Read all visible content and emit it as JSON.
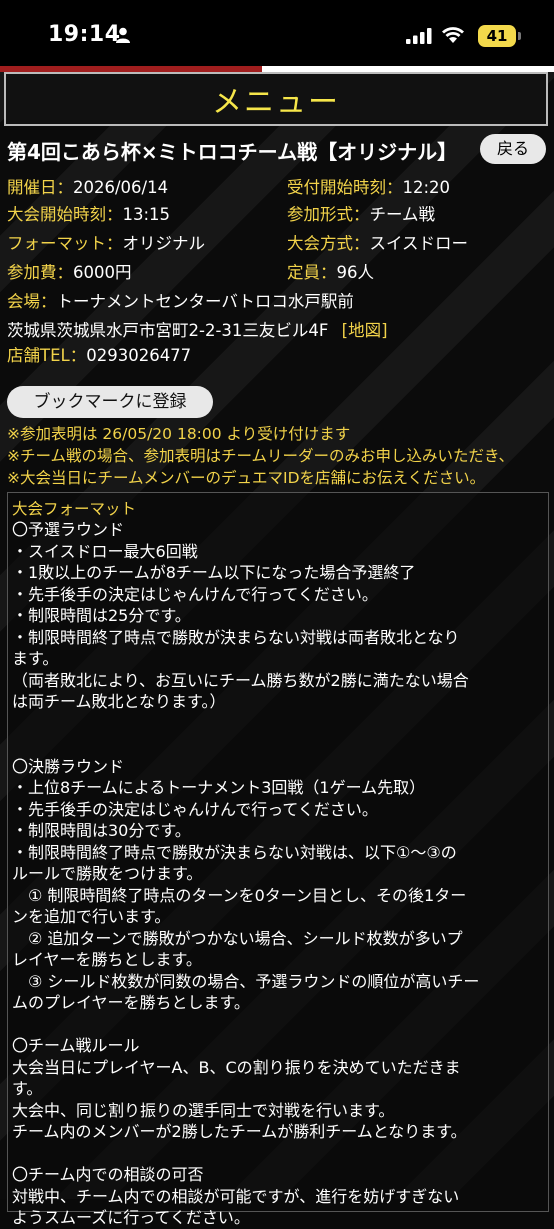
{
  "status_bar": {
    "time": "19:14",
    "battery": "41"
  },
  "menu": {
    "label": "メニュー"
  },
  "event": {
    "title": "第4回こあら杯×ミトロコチーム戦【オリジナル】",
    "back_label": "戻る",
    "info": [
      {
        "key": "開催日：",
        "value": "2026/06/14"
      },
      {
        "key": "受付開始時刻：",
        "value": "12:20"
      },
      {
        "key": "大会開始時刻：",
        "value": "13:15"
      },
      {
        "key": "参加形式：",
        "value": "チーム戦"
      },
      {
        "key": "フォーマット：",
        "value": "オリジナル"
      },
      {
        "key": "大会方式：",
        "value": "スイスドロー"
      },
      {
        "key": "参加費：",
        "value": "6000円"
      },
      {
        "key": "定員：",
        "value": "96人"
      }
    ],
    "venue_key": "会場：",
    "venue_value": "トーナメントセンターバトロコ水戸駅前",
    "address": "茨城県茨城県水戸市宮町2-2-31三友ビル4F",
    "map_link": "[地図]",
    "tel_key": "店舗TEL：",
    "tel_value": "0293026477",
    "bookmark_label": "ブックマークに登録",
    "notices": [
      "※参加表明は 26/05/20 18:00 より受け付けます",
      "※チーム戦の場合、参加表明はチームリーダーのみお申し込みいただき、",
      "※大会当日にチームメンバーのデュエマIDを店舗にお伝えください。"
    ]
  },
  "format": {
    "title": "大会フォーマット",
    "lines": [
      "〇予選ラウンド",
      "・スイスドロー最大6回戦",
      "・1敗以上のチームが8チーム以下になった場合予選終了",
      "・先手後手の決定はじゃんけんで行ってください。",
      "・制限時間は25分です。",
      "・制限時間終了時点で勝敗が決まらない対戦は両者敗北となり",
      "ます。",
      "（両者敗北により、お互いにチーム勝ち数が2勝に満たない場合",
      "は両チーム敗北となります。）",
      "",
      "",
      "〇決勝ラウンド",
      "・上位8チームによるトーナメント3回戦（1ゲーム先取）",
      "・先手後手の決定はじゃんけんで行ってください。",
      "・制限時間は30分です。",
      "・制限時間終了時点で勝敗が決まらない対戦は、以下①～③の",
      "ルールで勝敗をつけます。",
      "　① 制限時間終了時点のターンを0ターン目とし、その後1ター",
      "ンを追加で行います。",
      "　② 追加ターンで勝敗がつかない場合、シールド枚数が多いプ",
      "レイヤーを勝ちとします。",
      "　③ シールド枚数が同数の場合、予選ラウンドの順位が高いチー",
      "ムのプレイヤーを勝ちとします。",
      "",
      "〇チーム戦ルール",
      "大会当日にプレイヤーA、B、Cの割り振りを決めていただきま",
      "す。",
      "大会中、同じ割り振りの選手同士で対戦を行います。",
      "チーム内のメンバーが2勝したチームが勝利チームとなります。",
      "",
      "〇チーム内での相談の可否",
      "対戦中、チーム内での相談が可能ですが、進行を妨げすぎない",
      "ようスムーズに行ってください。"
    ]
  }
}
